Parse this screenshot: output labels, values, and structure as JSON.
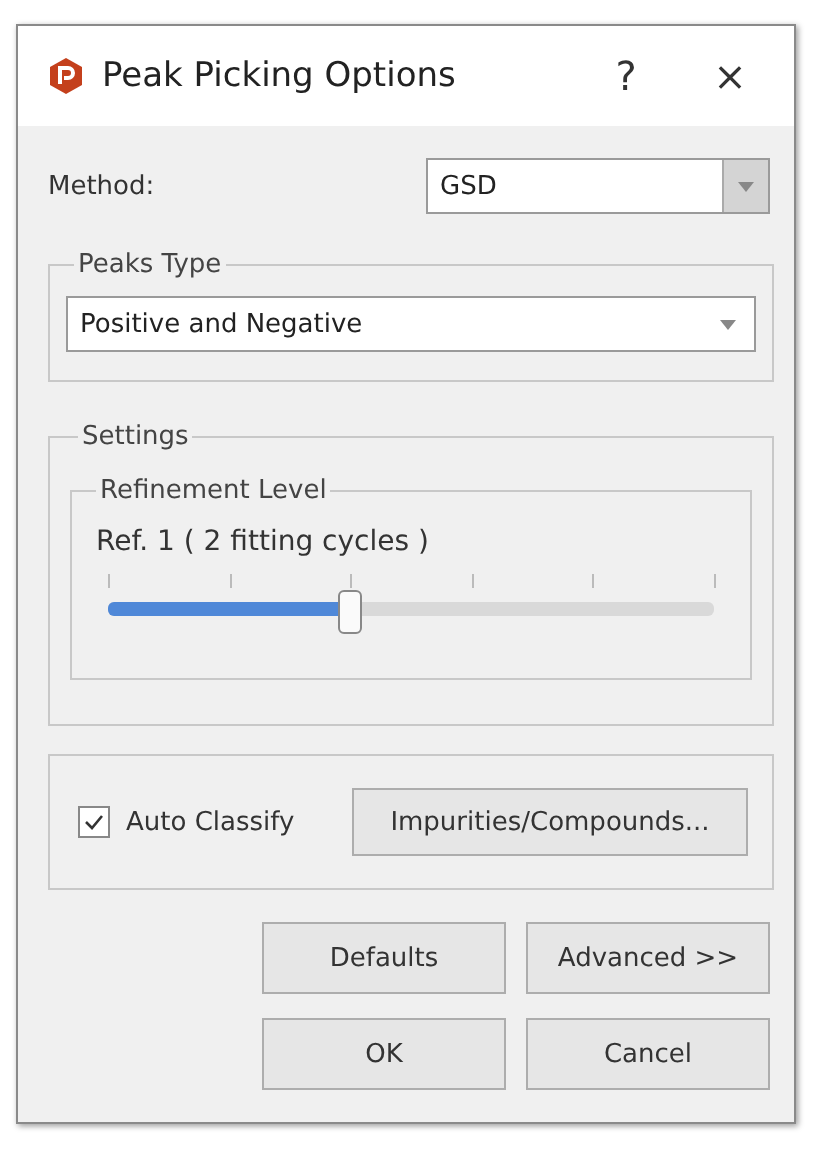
{
  "window": {
    "title": "Peak Picking Options",
    "help": "?",
    "close": "×"
  },
  "method": {
    "label": "Method:",
    "value": "GSD"
  },
  "peaks_type": {
    "title": "Peaks Type",
    "value": "Positive and Negative"
  },
  "settings": {
    "title": "Settings",
    "refinement": {
      "title": "Refinement Level",
      "reading": "Ref. 1 ( 2 fitting cycles )",
      "level": 0.4
    }
  },
  "auto_classify": {
    "label": "Auto Classify",
    "checked": true,
    "button": "Impurities/Compounds..."
  },
  "buttons": [
    [
      "Defaults",
      "Advanced >>"
    ],
    [
      "OK",
      "Cancel"
    ]
  ]
}
